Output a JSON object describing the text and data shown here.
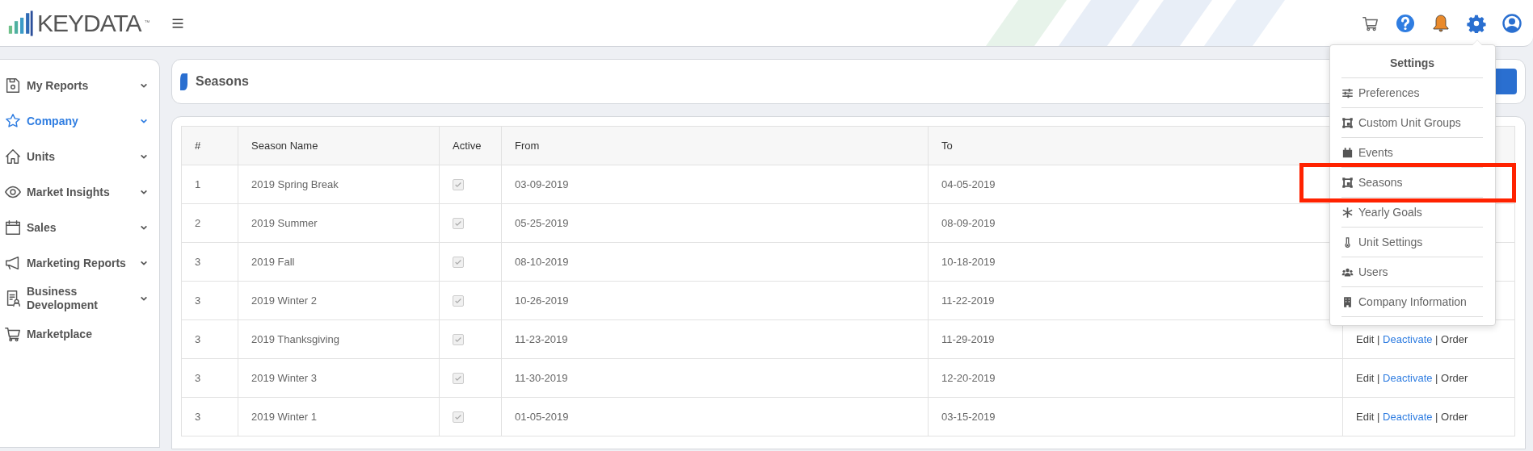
{
  "header": {
    "logo": "KEYDATA",
    "logo_mark": "™"
  },
  "sidebar": {
    "items": [
      {
        "label": "My Reports",
        "selected": false,
        "has_submenu": true
      },
      {
        "label": "Company",
        "selected": true,
        "has_submenu": true
      },
      {
        "label": "Units",
        "selected": false,
        "has_submenu": true
      },
      {
        "label": "Market Insights",
        "selected": false,
        "has_submenu": true
      },
      {
        "label": "Sales",
        "selected": false,
        "has_submenu": true
      },
      {
        "label": "Marketing Reports",
        "selected": false,
        "has_submenu": true
      },
      {
        "label": "Business Development",
        "selected": false,
        "has_submenu": true
      },
      {
        "label": "Marketplace",
        "selected": false,
        "has_submenu": false
      }
    ]
  },
  "page_title": "Seasons",
  "table": {
    "action_separator": "|",
    "columns": [
      "#",
      "Season Name",
      "Active",
      "From",
      "To"
    ],
    "rows": [
      {
        "number": "1",
        "name": "2019 Spring Break",
        "checked": true,
        "from": "03-09-2019",
        "to": "04-05-2019"
      },
      {
        "number": "2",
        "name": "2019 Summer",
        "checked": true,
        "from": "05-25-2019",
        "to": "08-09-2019"
      },
      {
        "number": "3",
        "name": "2019 Fall",
        "checked": true,
        "from": "08-10-2019",
        "to": "10-18-2019"
      },
      {
        "number": "3",
        "name": "2019 Winter 2",
        "checked": true,
        "from": "10-26-2019",
        "to": "11-22-2019"
      },
      {
        "number": "3",
        "name": "2019 Thanksgiving",
        "checked": true,
        "from": "11-23-2019",
        "to": "11-29-2019",
        "actions": [
          {
            "label": "Edit",
            "kind": "plain"
          },
          {
            "label": "Deactivate",
            "kind": "link"
          },
          {
            "label": "Order",
            "kind": "plain"
          }
        ]
      },
      {
        "number": "3",
        "name": "2019 Winter 3",
        "checked": true,
        "from": "11-30-2019",
        "to": "12-20-2019",
        "actions": [
          {
            "label": "Edit",
            "kind": "plain"
          },
          {
            "label": "Deactivate",
            "kind": "link"
          },
          {
            "label": "Order",
            "kind": "plain"
          }
        ]
      },
      {
        "number": "3",
        "name": "2019 Winter 1",
        "checked": true,
        "from": "01-05-2019",
        "to": "03-15-2019",
        "actions": [
          {
            "label": "Edit",
            "kind": "plain"
          },
          {
            "label": "Deactivate",
            "kind": "link"
          },
          {
            "label": "Order",
            "kind": "plain"
          }
        ]
      }
    ]
  },
  "settings_menu": {
    "title": "Settings",
    "items": [
      {
        "label": "Preferences",
        "highlighted": false
      },
      {
        "label": "Custom Unit Groups",
        "highlighted": false
      },
      {
        "label": "Events",
        "highlighted": false
      },
      {
        "label": "Seasons",
        "highlighted": true
      },
      {
        "label": "Yearly Goals",
        "highlighted": false
      },
      {
        "label": "Unit Settings",
        "highlighted": false
      },
      {
        "label": "Users",
        "highlighted": false
      },
      {
        "label": "Company Information",
        "highlighted": false
      }
    ]
  }
}
